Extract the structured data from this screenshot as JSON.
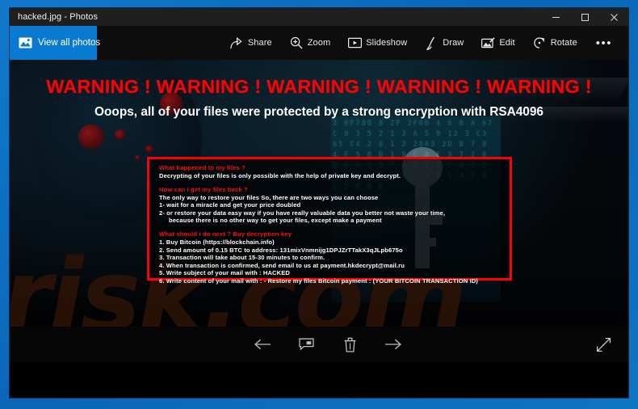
{
  "window": {
    "title": "hacked.jpg - Photos",
    "controls": {
      "minimize": "minimize-button",
      "maximize": "maximize-button",
      "close": "close-button"
    }
  },
  "command_bar": {
    "view_all_label": "View all photos",
    "view_all_icon": "photos-library-icon",
    "tools": [
      {
        "label": "Share",
        "icon": "share-icon"
      },
      {
        "label": "Zoom",
        "icon": "magnifier-plus-icon"
      },
      {
        "label": "Slideshow",
        "icon": "slideshow-icon"
      },
      {
        "label": "Draw",
        "icon": "pen-icon"
      },
      {
        "label": "Edit",
        "icon": "edit-image-icon"
      },
      {
        "label": "Rotate",
        "icon": "rotate-icon"
      }
    ],
    "more_label": "•••",
    "more_icon": "more-options-icon"
  },
  "image": {
    "watermark": "risk.com",
    "headline_warning": "WARNING !  WARNING !  WARNING !  WARNING !  WARNING !",
    "headline_sub": "Ooops, all of your files were protected by a strong encryption with RSA4096",
    "hex_noise": "3 0F780 8 2F 2F6D 4 6 B A 67 C 0 3 5 2 1 3 A 5 9 12 3 C3 65 C4 2 6 1 2 28A3 2D B 7 0 4 F 5 8 D 1 9 C 4 E 3 7 2 0 B 6 A 2 9 7 4 D 3 1 F 8 5 C 0 6 B E 2 A 9 7 3 D 1 4 F 8 C 5 0 6 B",
    "note": {
      "sections": [
        {
          "question": "What happened to my files ?",
          "lines": [
            {
              "text": "Decrypting of your files is only possible with the help of private key and decrypt.",
              "indent": false
            }
          ]
        },
        {
          "question": "How can i get my files back ?",
          "lines": [
            {
              "text": "The only way to restore your files So, there are two ways you can choose",
              "indent": false
            },
            {
              "text": "1- wait for a miracle and get your price doubled",
              "indent": false
            },
            {
              "text": "2- or restore your data easy way if you have really valuable data you better not waste your time,",
              "indent": false
            },
            {
              "text": "because there is no other way to get your files, except make a payment",
              "indent": true
            }
          ]
        },
        {
          "question": "What should i do next ? Buy decryption key",
          "lines": [
            {
              "text": "1. Buy Bitcoin (https://blockchain.info)",
              "indent": false
            },
            {
              "text": "2. Send amount of  0.15 BTC to address:  131mixVnmnijg1DPJZrTTakX3qJLpb675o",
              "indent": false
            },
            {
              "text": "3. Transaction will take about 15-30 minutes to confirm.",
              "indent": false
            },
            {
              "text": "4. When transaction is confirmed, send email to us at payment.hkdecrypt@mail.ru",
              "indent": false
            },
            {
              "text": "5. Write subject of your mail with :  HACKED",
              "indent": false
            },
            {
              "text": "6. Write content of your mail with : - Restore my files Bitcoin payment : (YOUR BITCOIN TRANSACTION ID)",
              "indent": false
            }
          ]
        }
      ]
    }
  },
  "bottom_bar": {
    "buttons": [
      {
        "name": "previous-image-button",
        "icon": "arrow-left-icon"
      },
      {
        "name": "comment-button",
        "icon": "comment-icon"
      },
      {
        "name": "delete-button",
        "icon": "trash-icon"
      },
      {
        "name": "next-image-button",
        "icon": "arrow-right-icon"
      }
    ],
    "fullscreen": {
      "name": "fullscreen-button",
      "icon": "expand-diagonal-icon"
    }
  },
  "colors": {
    "accent_blue": "#0a7ad0",
    "desktop_blue": "#0b6ec4",
    "warning_red": "#f50606",
    "box_border_red": "#ff0000",
    "titlebar": "#1f1f1f",
    "canvas_black": "#000000",
    "watermark_brown": "#2a1206",
    "hex_teal": "#2f93a8"
  }
}
